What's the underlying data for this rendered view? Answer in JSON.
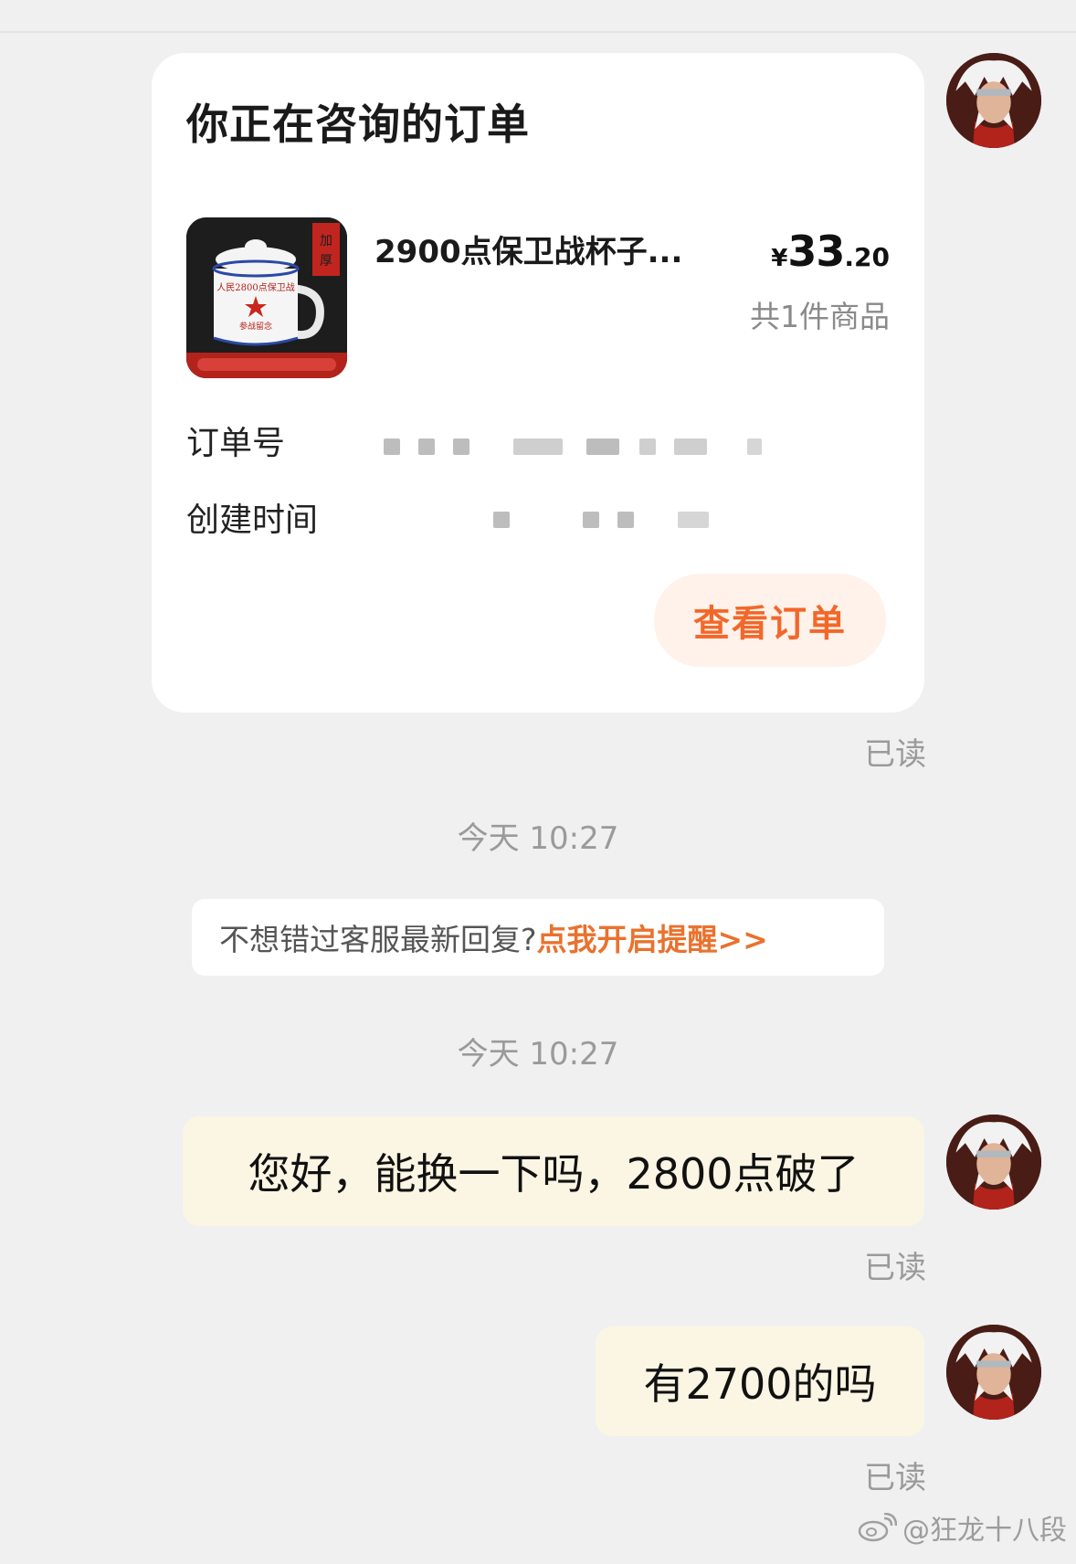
{
  "order_card": {
    "title": "你正在咨询的订单",
    "product": {
      "name": "2900点保卫战杯子...",
      "price_currency": "¥",
      "price_integer": "33",
      "price_decimal": ".20",
      "count_text": "共1件商品",
      "thumb_badge": "加厚",
      "thumb_slogan": "人民2800点保卫战",
      "thumb_sub": "参战留念"
    },
    "order_number_label": "订单号",
    "created_time_label": "创建时间",
    "view_order_label": "查看订单"
  },
  "read_label": "已读",
  "timestamps": [
    "今天 10:27",
    "今天 10:27"
  ],
  "notice": {
    "question": "不想错过客服最新回复?",
    "link": "点我开启提醒>>"
  },
  "messages": [
    {
      "text": "您好，能换一下吗，2800点破了"
    },
    {
      "text": "有2700的吗"
    }
  ],
  "watermark": "@狂龙十八段",
  "colors": {
    "accent_orange": "#f2682a",
    "bubble_bg": "#fbf5e3",
    "page_bg": "#f0f0f0"
  }
}
